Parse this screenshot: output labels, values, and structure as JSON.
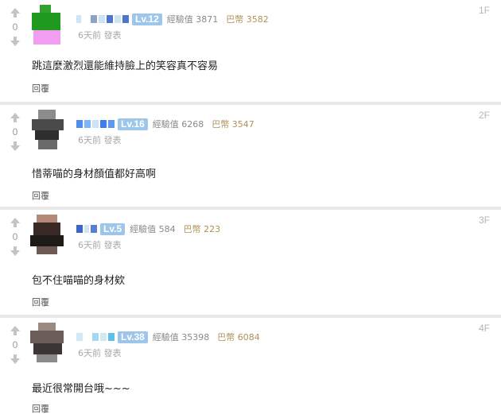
{
  "comments": [
    {
      "floor": "1F",
      "score": "0",
      "level": "Lv.12",
      "exp": "經驗值 3871",
      "gp": "巴幣 3582",
      "time": "6天前 發表",
      "text": "跳這麼激烈還能維持臉上的笑容真不容易",
      "reply": "回覆"
    },
    {
      "floor": "2F",
      "score": "0",
      "level": "Lv.16",
      "exp": "經驗值 6268",
      "gp": "巴幣 3547",
      "time": "6天前 發表",
      "text": "惜蒂喵的身材顏值都好高啊",
      "reply": "回覆"
    },
    {
      "floor": "3F",
      "score": "0",
      "level": "Lv.5",
      "exp": "經驗值 584",
      "gp": "巴幣 223",
      "time": "6天前 發表",
      "text": "包不住喵喵的身材欸",
      "reply": "回覆"
    },
    {
      "floor": "4F",
      "score": "0",
      "level": "Lv.38",
      "exp": "經驗值 35398",
      "gp": "巴幣 6084",
      "time": "6天前 發表",
      "text": "最近很常開台哦~~~",
      "reply": "回覆"
    }
  ],
  "colors": {
    "level_badge": "#9ec6ea",
    "gp_text": "#b0915a",
    "background": "#e9e9e9"
  },
  "icons": {
    "upvote": "arrow-up-icon",
    "downvote": "arrow-down-icon"
  }
}
